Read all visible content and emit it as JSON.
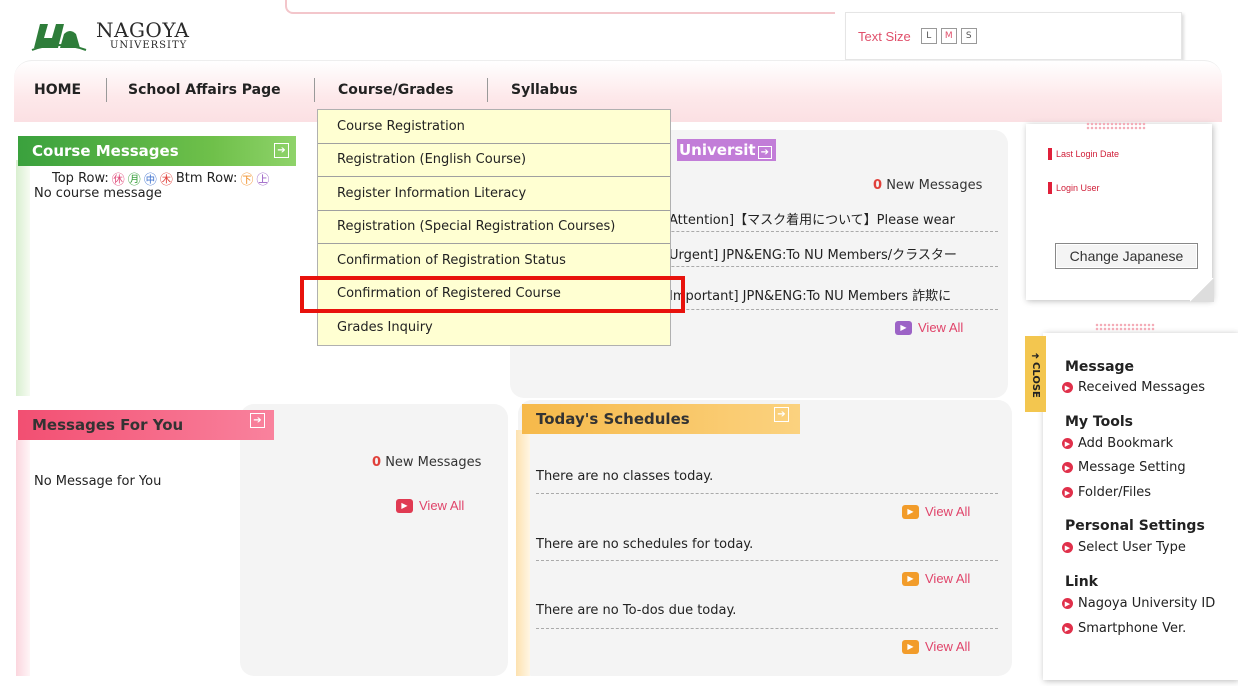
{
  "header": {
    "logo_main": "NAGOYA",
    "logo_sub": "UNIVERSITY",
    "text_size_label": "Text Size",
    "text_size_options": [
      "L",
      "M",
      "S"
    ]
  },
  "nav": {
    "home": "HOME",
    "school_affairs": "School Affairs Page",
    "course_grades": "Course/Grades",
    "syllabus": "Syllabus"
  },
  "dropdown": {
    "items": [
      "Course Registration",
      "Registration (English Course)",
      "Register Information Literacy",
      "Registration (Special Registration Courses)",
      "Confirmation of Registration Status",
      "Confirmation of Registered Course",
      "Grades Inquiry"
    ]
  },
  "course_messages": {
    "title": "Course Messages",
    "row_label": "Top Row:",
    "btm_label": "Btm Row:",
    "empty": "No course message"
  },
  "university": {
    "title_fragment": "Universit",
    "new_count": "0",
    "new_label": "New Messages",
    "items": [
      "Attention]【マスク着用について】Please wear",
      "Urgent] JPN&ENG:To NU Members/クラスター",
      "Important] JPN&ENG:To NU Members 詐欺に"
    ],
    "view_all": "View All"
  },
  "messages_for_you": {
    "title": "Messages For You",
    "new_count": "0",
    "new_label": "New Messages",
    "empty": "No Message for You",
    "view_all": "View All"
  },
  "schedules": {
    "title": "Today's Schedules",
    "classes": "There are no classes today.",
    "schedules": "There are no schedules for today.",
    "todos": "There are no To-dos due today.",
    "view_all": "View All"
  },
  "login_card": {
    "last_login": "Last Login Date",
    "login_user": "Login User",
    "change_lang": "Change Japanese"
  },
  "sidebar": {
    "close": "CLOSE",
    "message_head": "Message",
    "received": "Received Messages",
    "tools_head": "My Tools",
    "bookmark": "Add Bookmark",
    "msg_setting": "Message Setting",
    "folder": "Folder/Files",
    "personal_head": "Personal Settings",
    "user_type": "Select User Type",
    "link_head": "Link",
    "nu_id": "Nagoya University ID",
    "smartphone": "Smartphone Ver."
  },
  "colors": {
    "green": "#3aa13d",
    "pink": "#f24f72",
    "orange": "#f6b94a",
    "highlight": "#e8120c",
    "dropdown_bg": "#ffffd2"
  }
}
